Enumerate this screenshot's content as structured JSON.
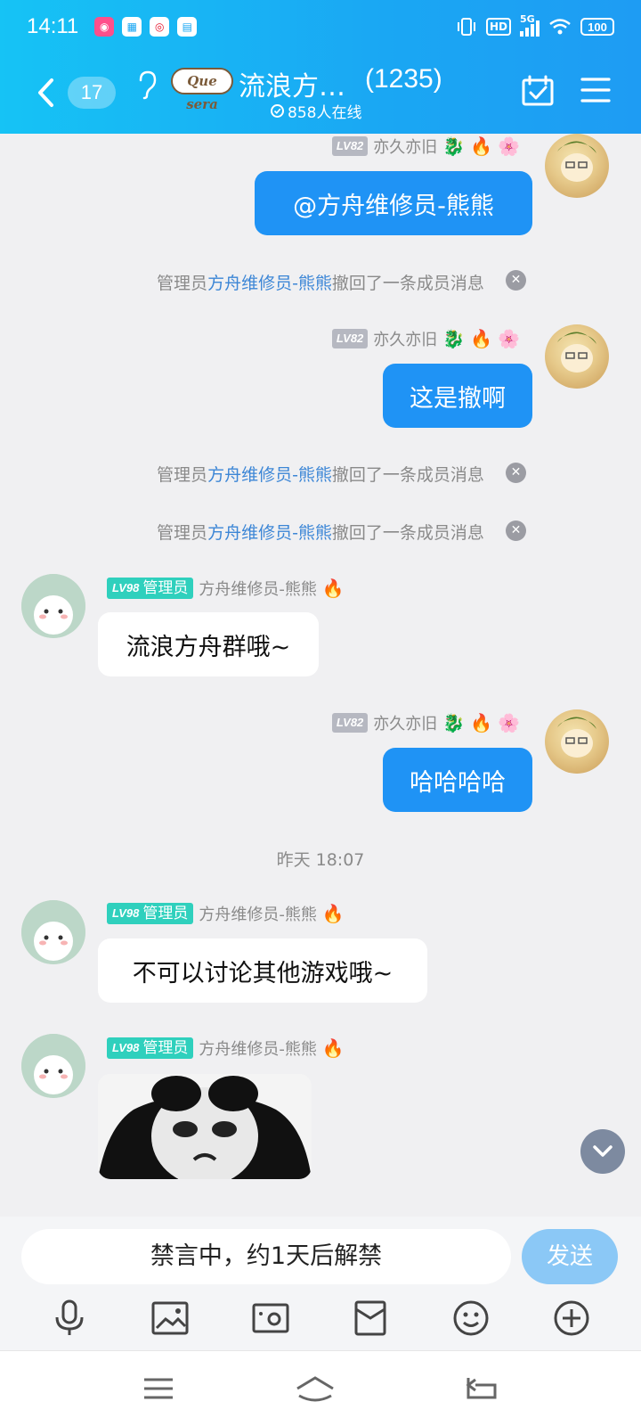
{
  "status_bar": {
    "time": "14:11",
    "network": "5G",
    "hd": "HD",
    "battery": "100"
  },
  "header": {
    "back_count": "17",
    "brand_logo_text": "Que sera",
    "group_name": "流浪方…",
    "member_count": "(1235)",
    "online_text": "858人在线"
  },
  "messages": {
    "m1": {
      "level": "LV82",
      "sender": "亦久亦旧",
      "text": "@方舟维修员-熊熊"
    },
    "sys1": {
      "prefix": "管理员",
      "admin_name": "方舟维修员-熊熊",
      "suffix": "撤回了一条成员消息"
    },
    "m2": {
      "level": "LV82",
      "sender": "亦久亦旧",
      "text": "这是撤啊"
    },
    "sys2": {
      "prefix": "管理员",
      "admin_name": "方舟维修员-熊熊",
      "suffix": "撤回了一条成员消息"
    },
    "sys3": {
      "prefix": "管理员",
      "admin_name": "方舟维修员-熊熊",
      "suffix": "撤回了一条成员消息"
    },
    "m3": {
      "level": "LV98",
      "role": "管理员",
      "sender": "方舟维修员-熊熊",
      "text": "流浪方舟群哦~"
    },
    "m4": {
      "level": "LV82",
      "sender": "亦久亦旧",
      "text": "哈哈哈哈"
    },
    "timestamp": "昨天 18:07",
    "m5": {
      "level": "LV98",
      "role": "管理员",
      "sender": "方舟维修员-熊熊",
      "text": "不可以讨论其他游戏哦~"
    },
    "m6": {
      "level": "LV98",
      "role": "管理员",
      "sender": "方舟维修员-熊熊",
      "sticker": "panda-meme-sticker"
    }
  },
  "input": {
    "mute_notice": "禁言中，约1天后解禁",
    "send_label": "发送"
  },
  "toolbar_icons": [
    "microphone-icon",
    "image-icon",
    "camera-icon",
    "red-packet-icon",
    "emoji-icon",
    "plus-icon"
  ],
  "colors": {
    "header_start": "#16c3f5",
    "header_end": "#1e9cf3",
    "my_bubble": "#1f93f5",
    "admin_badge": "#2fd0bd",
    "link": "#3c86d6"
  }
}
